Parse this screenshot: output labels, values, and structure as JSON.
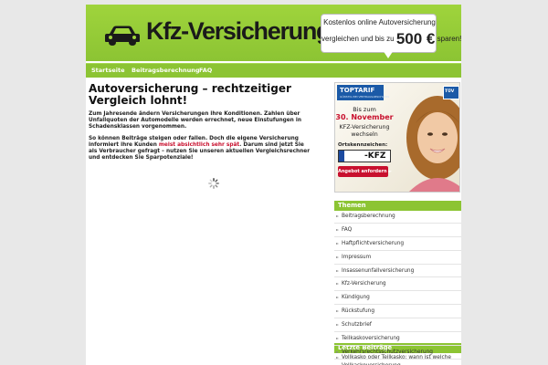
{
  "header": {
    "logo_text": "Kfz-Versicherung",
    "promo_line1": "Kostenlos online Autoversicherung",
    "promo_line2_pre": "vergleichen und bis zu",
    "promo_amount": "500 €",
    "promo_line2_post": "sparen!"
  },
  "nav": {
    "items": [
      {
        "label": "Startseite"
      },
      {
        "label": "Beitragsberechnung"
      },
      {
        "label": "FAQ"
      }
    ]
  },
  "article": {
    "title": "Autoversicherung – rechtzeitiger Vergleich lohnt!",
    "para1": "Zum Jahresende ändern Versicherungen ihre Konditionen. Zahlen über Unfallquoten der Automodelle werden errechnet, neue Einstufungen in Schadensklassen vorgenommen.",
    "para2_pre": "So können Beiträge steigen oder fallen. Doch die eigene Versicherung informiert ihre Kunden ",
    "para2_highlight": "meist absichtlich sehr spät",
    "para2_post": ". Darum sind jetzt Sie als Verbraucher gefragt – nutzen Sie unseren aktuellen Vergleichsrechner und entdecken Sie Sparpotenziale!"
  },
  "ad": {
    "brand": "TOPTARIF",
    "brand_sub": "GÜNSTIG BEI VERTRAGSABSCHLUSS",
    "seal": "TÜV",
    "bis": "Bis zum",
    "date": "30. November",
    "kfz_line": "KFZ-Versicherung",
    "wechseln": "wechseln",
    "ort_label": "Ortskennzeichen:",
    "plate_text": "-KFZ",
    "button": "Angebot anfordern ►"
  },
  "sidebar": {
    "themen_title": "Themen",
    "themen": [
      "Beitragsberechnung",
      "FAQ",
      "Haftpflichtversicherung",
      "Impressum",
      "Insassenunfallversicherung",
      "Kfz-Versicherung",
      "Kündigung",
      "Rückstufung",
      "Schutzbrief",
      "Teilkaskoversicherung",
      "Verkehrsrechtsschutzversicherung",
      "Vollkaskoversicherung"
    ],
    "recent_title": "Letzte Beiträge",
    "recent": [
      "Vollkasko oder Teilkasko: wann ist welche"
    ]
  },
  "colors": {
    "accent_green": "#8cc433",
    "highlight_red": "#c8102e",
    "brand_blue": "#1b5aa7"
  }
}
